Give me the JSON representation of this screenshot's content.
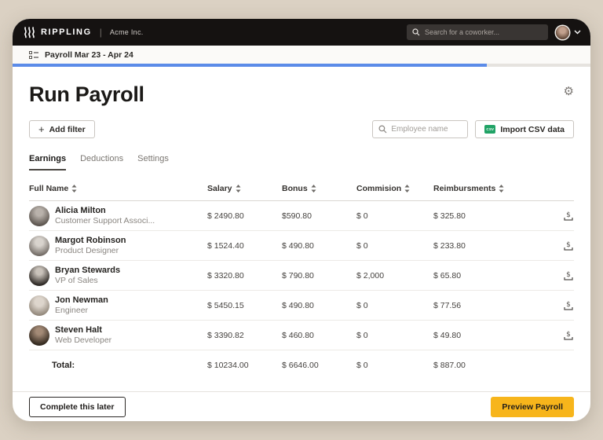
{
  "topbar": {
    "logo_text": "RIPPLING",
    "company": "Acme Inc.",
    "search_placeholder": "Search for a coworker..."
  },
  "breadcrumb": {
    "label": "Payroll Mar 23 - Apr 24"
  },
  "progress": {
    "percent": 82
  },
  "page": {
    "title": "Run Payroll"
  },
  "icons": {
    "gear_glyph": "⚙",
    "plus_glyph": "+",
    "csv_badge_label": "CSV"
  },
  "toolbar": {
    "add_filter_label": "Add filter",
    "employee_search_placeholder": "Employee name",
    "import_csv_label": "Import CSV data"
  },
  "tabs": [
    {
      "label": "Earnings",
      "active": true
    },
    {
      "label": "Deductions",
      "active": false
    },
    {
      "label": "Settings",
      "active": false
    }
  ],
  "table": {
    "columns": [
      "Full Name",
      "Salary",
      "Bonus",
      "Commision",
      "Reimbursments"
    ],
    "rows": [
      {
        "name": "Alicia Milton",
        "role": "Customer Support Associ...",
        "salary": "$ 2490.80",
        "bonus": "$590.80",
        "commission": "$ 0",
        "reimbursement": "$ 325.80"
      },
      {
        "name": "Margot Robinson",
        "role": "Product Designer",
        "salary": "$ 1524.40",
        "bonus": "$ 490.80",
        "commission": "$ 0",
        "reimbursement": "$ 233.80"
      },
      {
        "name": "Bryan Stewards",
        "role": "VP of Sales",
        "salary": "$ 3320.80",
        "bonus": "$ 790.80",
        "commission": "$ 2,000",
        "reimbursement": "$ 65.80"
      },
      {
        "name": "Jon Newman",
        "role": "Engineer",
        "salary": "$ 5450.15",
        "bonus": "$ 490.80",
        "commission": "$ 0",
        "reimbursement": "$ 77.56"
      },
      {
        "name": "Steven Halt",
        "role": "Web Developer",
        "salary": "$ 3390.82",
        "bonus": "$ 460.80",
        "commission": "$ 0",
        "reimbursement": "$ 49.80"
      }
    ],
    "total": {
      "label": "Total:",
      "salary": "$ 10234.00",
      "bonus": "$ 6646.00",
      "commission": "$ 0",
      "reimbursement": "$ 887.00"
    }
  },
  "footer": {
    "secondary_label": "Complete this later",
    "primary_label": "Preview Payroll"
  },
  "colors": {
    "canvas_beige": "#DBD1C3",
    "topbar_black": "#151211",
    "progress_blue": "#5B8BE8",
    "accent_yellow": "#F7B51B",
    "csv_green": "#21A366"
  }
}
